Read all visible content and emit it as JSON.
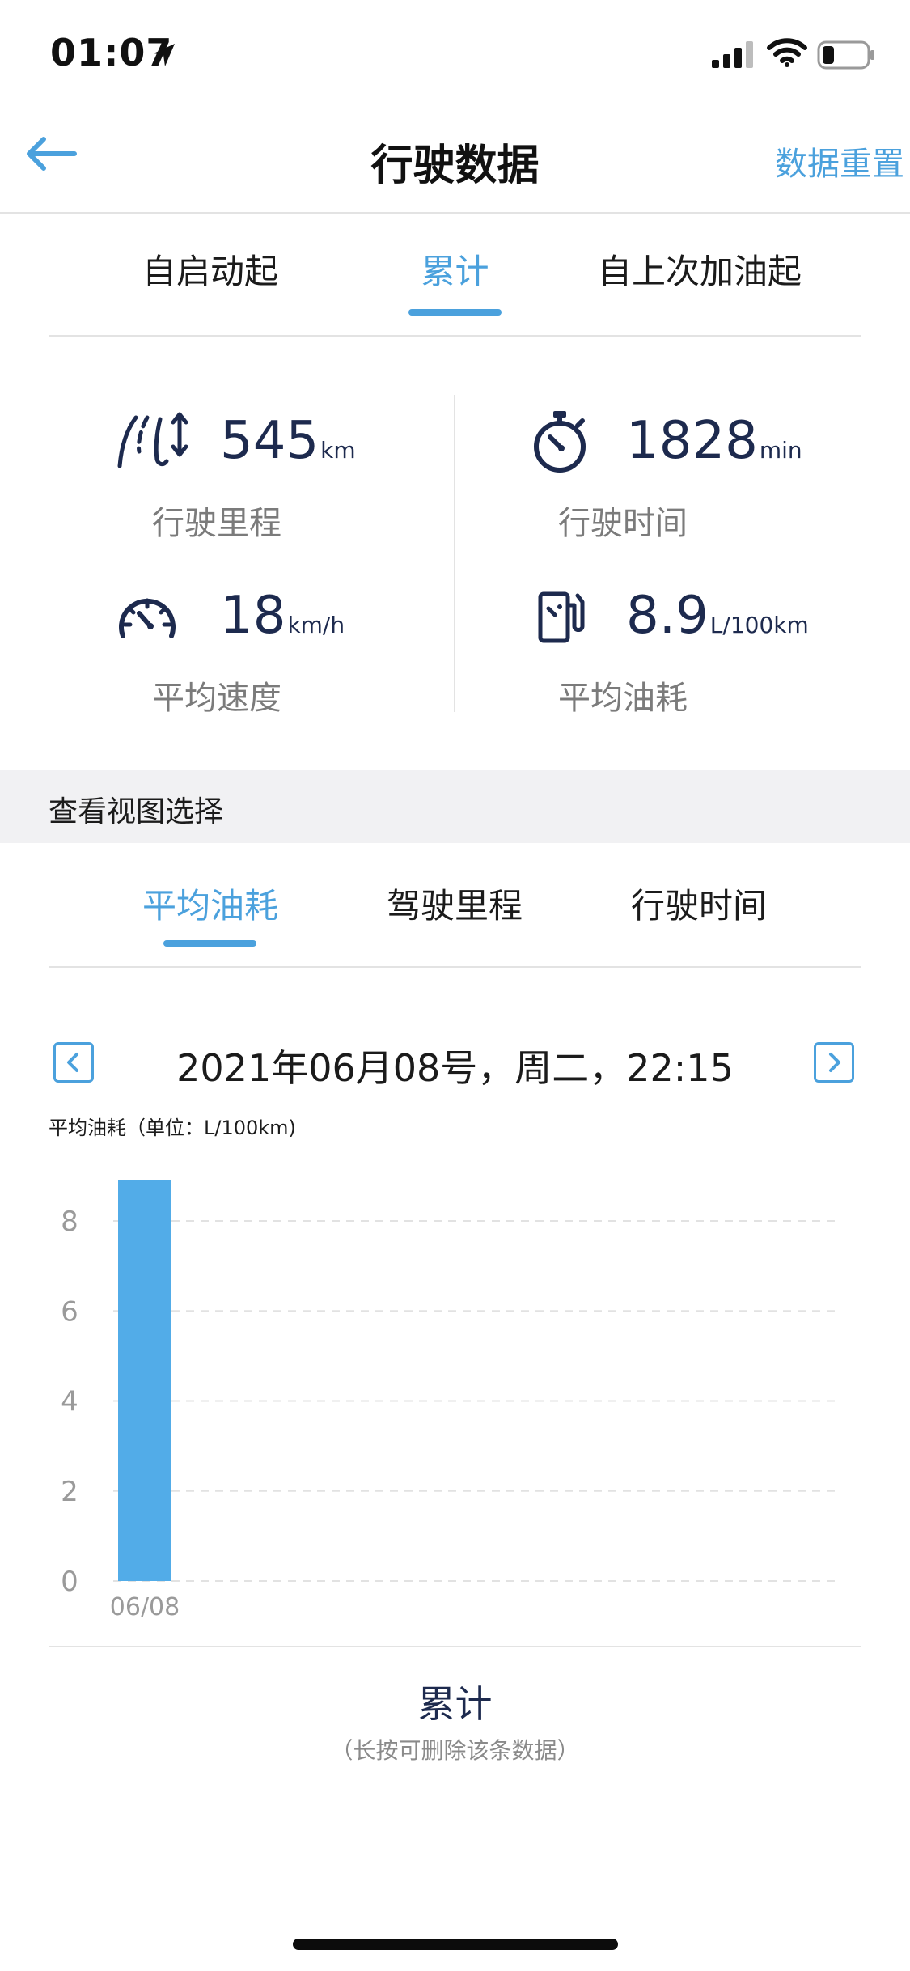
{
  "status_bar": {
    "time": "01:07"
  },
  "nav": {
    "title": "行驶数据",
    "reset_label": "数据重置"
  },
  "tabs": [
    {
      "label": "自启动起",
      "active": false
    },
    {
      "label": "累计",
      "active": true
    },
    {
      "label": "自上次加油起",
      "active": false
    }
  ],
  "stats": {
    "distance": {
      "value": "545",
      "unit": "km",
      "label": "行驶里程",
      "icon": "road-icon"
    },
    "time": {
      "value": "1828",
      "unit": "min",
      "label": "行驶时间",
      "icon": "stopwatch-icon"
    },
    "speed": {
      "value": "18",
      "unit": "km/h",
      "label": "平均速度",
      "icon": "speedometer-icon"
    },
    "fuel": {
      "value": "8.9",
      "unit": "L/100km",
      "label": "平均油耗",
      "icon": "fuel-pump-icon"
    }
  },
  "view_section": {
    "title": "查看视图选择"
  },
  "view_tabs": [
    {
      "label": "平均油耗",
      "active": true
    },
    {
      "label": "驾驶里程",
      "active": false
    },
    {
      "label": "行驶时间",
      "active": false
    }
  ],
  "date_nav": {
    "text": "2021年06月08号，周二，22:15"
  },
  "chart_caption": "平均油耗（单位：L/100km)",
  "chart_data": {
    "type": "bar",
    "categories": [
      "06/08"
    ],
    "values": [
      8.9
    ],
    "yticks": [
      0,
      2,
      4,
      6,
      8
    ],
    "ylim": [
      0,
      9.6
    ],
    "grid": true,
    "bar_color": "#52ace8"
  },
  "footer": {
    "title": "累计",
    "hint": "（长按可删除该条数据）"
  },
  "colors": {
    "accent": "#4ba1dd",
    "value": "#1d2a4e"
  }
}
